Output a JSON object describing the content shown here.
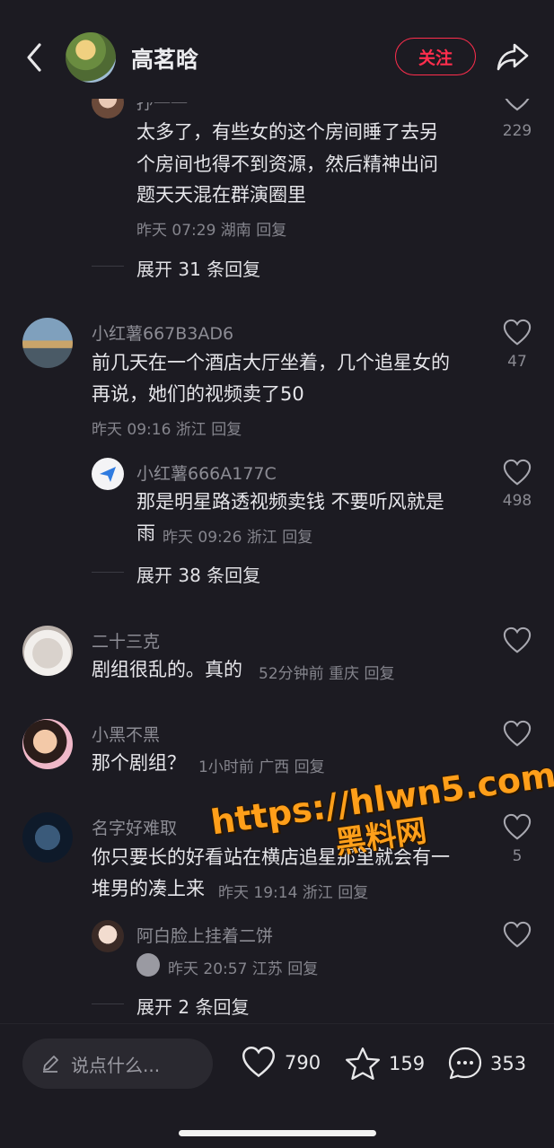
{
  "header": {
    "username": "高茗晗",
    "follow_label": "关注"
  },
  "comments": {
    "c0": {
      "name": "抒一一",
      "text_lines": [
        "太多了，有些女的这个房间睡了去另",
        "个房间也得不到资源，然后精神出问",
        "题天天混在群演圈里"
      ],
      "meta": "昨天 07:29 湖南 回复",
      "likes": "229",
      "expand": "展开 31 条回复"
    },
    "c1": {
      "name": "小红薯667B3AD6",
      "text_lines": [
        "前几天在一个酒店大厅坐着，几个追星女的",
        "再说，她们的视频卖了50"
      ],
      "meta": "昨天 09:16 浙江 回复",
      "likes": "47",
      "reply": {
        "name": "小红薯666A177C",
        "text_line1": "那是明星路透视频卖钱 不要听风就是",
        "text_line2": "雨",
        "meta": "昨天 09:26 浙江 回复",
        "likes": "498"
      },
      "expand": "展开 38 条回复"
    },
    "c2": {
      "name": "二十三克",
      "text": "剧组很乱的。真的",
      "meta": "52分钟前 重庆 回复"
    },
    "c3": {
      "name": "小黑不黑",
      "text": "那个剧组？",
      "meta": "1小时前 广西 回复"
    },
    "c4": {
      "name": "名字好难取",
      "text_line1": "你只要长的好看站在横店追星那里就会有一",
      "text_line2": "堆男的凑上来",
      "meta": "昨天 19:14 浙江 回复",
      "likes": "5",
      "reply": {
        "name": "阿白脸上挂着二饼",
        "meta": "昨天 20:57 江苏 回复"
      },
      "expand": "展开 2 条回复"
    }
  },
  "bottom_bar": {
    "input_placeholder": "说点什么...",
    "likes": "790",
    "stars": "159",
    "comments": "353"
  },
  "watermark": {
    "line1": "https://hlwn5.com",
    "line2": "黑料网"
  },
  "colors": {
    "background": "#1c1b22",
    "accent": "#ff2e4d",
    "watermark": "#ff9f1a"
  }
}
